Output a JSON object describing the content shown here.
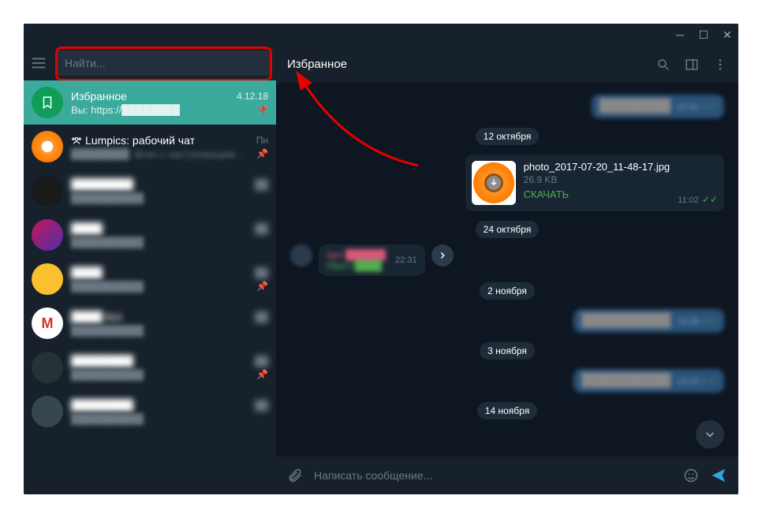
{
  "window": {
    "title": ""
  },
  "search": {
    "placeholder": "Найти..."
  },
  "chats": [
    {
      "name": "Избранное",
      "date": "4.12.18",
      "preview": "Вы: https://████████",
      "pinned": true,
      "type": "saved"
    },
    {
      "name": "Lumpics: рабочий чат",
      "date": "Пн",
      "preview": "████████: Всех с наступающим...",
      "pinned": true,
      "type": "group"
    },
    {
      "name": "████████",
      "date": "██",
      "preview": "██████████",
      "pinned": false
    },
    {
      "name": "████",
      "date": "██",
      "preview": "██████████",
      "pinned": false
    },
    {
      "name": "████",
      "date": "██",
      "preview": "██████████",
      "pinned": true
    },
    {
      "name": "████ Bot",
      "date": "██",
      "preview": "██████████",
      "pinned": false
    },
    {
      "name": "████████",
      "date": "██",
      "preview": "██████████",
      "pinned": true
    },
    {
      "name": "████████",
      "date": "██",
      "preview": "██████████",
      "pinned": false
    }
  ],
  "header": {
    "title": "Избранное"
  },
  "messages": {
    "out_top_time": "22:41",
    "date1": "12 октября",
    "file": {
      "name": "photo_2017-07-20_11-48-17.jpg",
      "size": "26.9 KB",
      "action": "СКАЧАТЬ",
      "time": "11:02"
    },
    "date2": "24 октября",
    "fwd": {
      "who": "Igor ██████",
      "what": "https://████",
      "time": "22:31"
    },
    "date3": "2 ноября",
    "out3_time": "19:38",
    "date4": "3 ноября",
    "out4_time": "14:24",
    "date5": "14 ноября"
  },
  "composer": {
    "placeholder": "Написать сообщение..."
  }
}
